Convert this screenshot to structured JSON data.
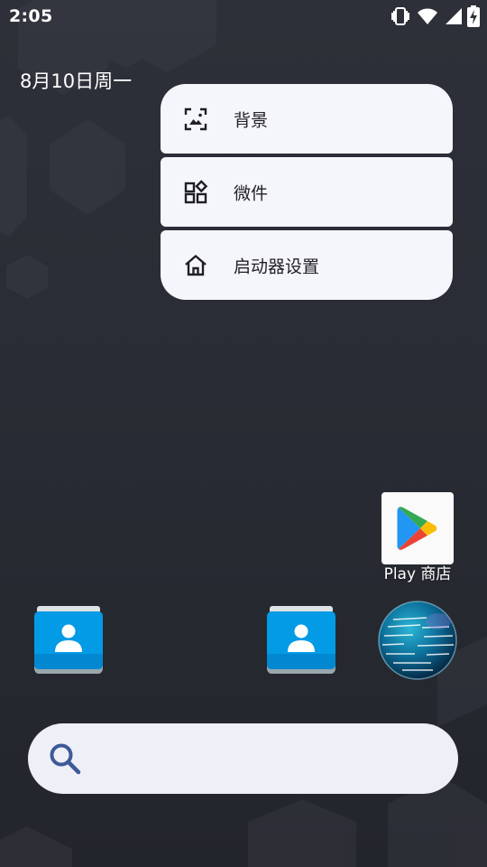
{
  "status_bar": {
    "time": "2:05",
    "icons": [
      "vibrate-icon",
      "wifi-icon",
      "signal-icon",
      "battery-charging-icon"
    ]
  },
  "home": {
    "date": "8月10日周一"
  },
  "context_menu": {
    "items": [
      {
        "label": "背景",
        "icon": "wallpaper-icon"
      },
      {
        "label": "微件",
        "icon": "widgets-icon"
      },
      {
        "label": "启动器设置",
        "icon": "home-settings-icon"
      }
    ]
  },
  "apps": {
    "play_store": {
      "label": "Play 商店",
      "icon": "play-store-icon"
    },
    "contacts_1": {
      "icon": "contacts-icon"
    },
    "contacts_2": {
      "icon": "contacts-icon"
    },
    "globe_app": {
      "icon": "globe-icon"
    }
  },
  "search": {
    "icon": "search-icon",
    "placeholder": ""
  },
  "colors": {
    "menu_background": "#f5f5fc",
    "search_background": "#efeff8",
    "wallpaper": "#2a2c35",
    "search_icon": "#3d5a98"
  }
}
